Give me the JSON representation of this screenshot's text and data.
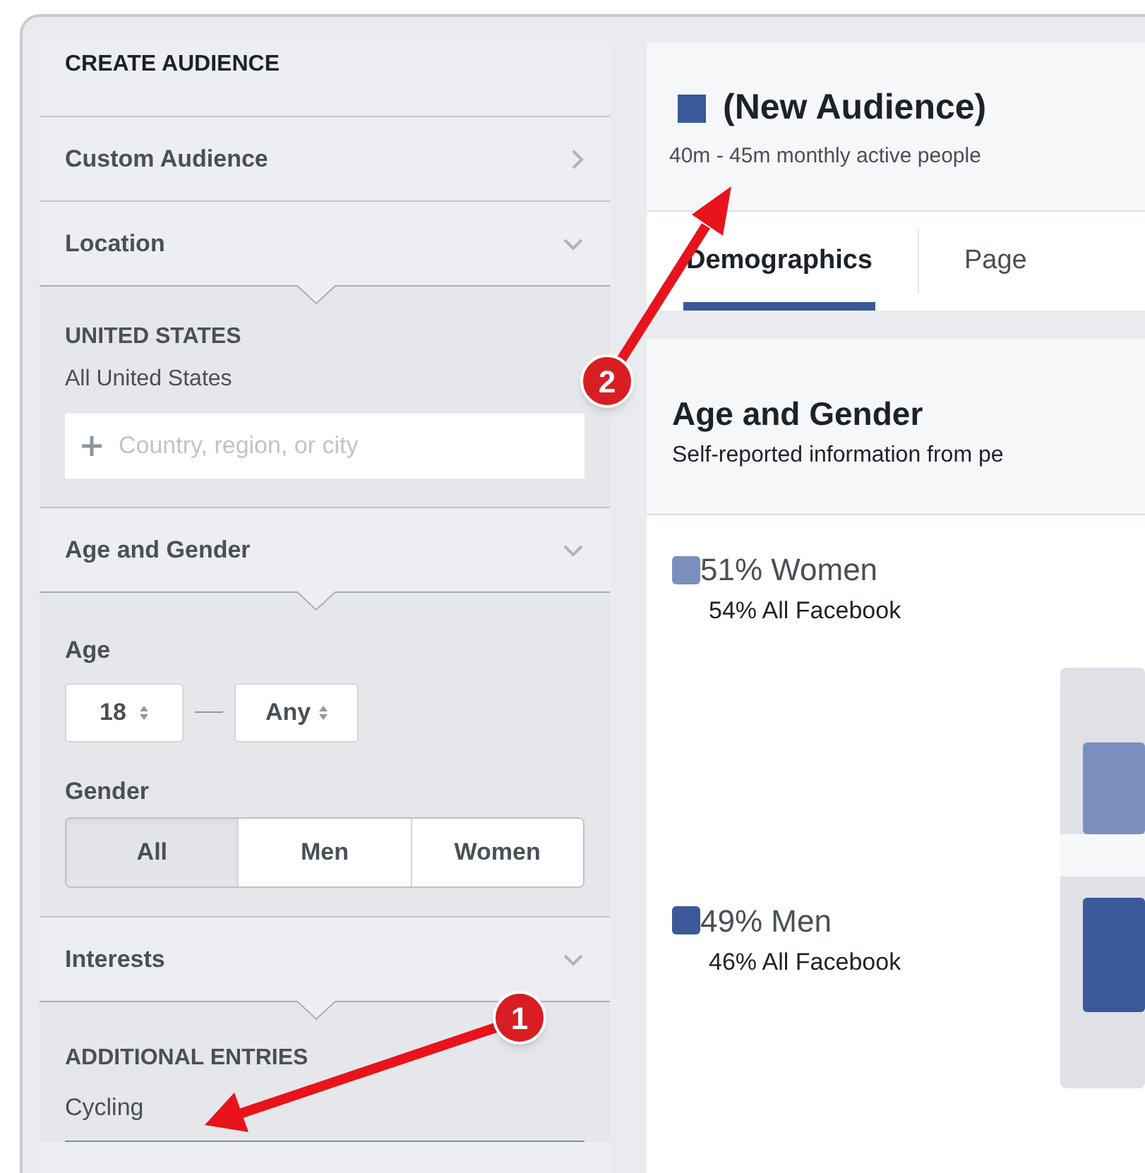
{
  "sidebar": {
    "title": "CREATE AUDIENCE",
    "sections": [
      {
        "kind": "link",
        "label": "Custom Audience"
      },
      {
        "kind": "location",
        "label": "Location",
        "expanded": true,
        "region": "UNITED STATES",
        "region_value": "All United States",
        "placeholder": "Country, region, or city"
      },
      {
        "kind": "age_gender",
        "label": "Age and Gender",
        "expanded": true,
        "age_label": "Age",
        "age_min": "18",
        "age_max": "Any",
        "gender_label": "Gender",
        "genders": [
          {
            "label": "All",
            "selected": true
          },
          {
            "label": "Men",
            "selected": false
          },
          {
            "label": "Women",
            "selected": false
          }
        ]
      },
      {
        "kind": "interests",
        "label": "Interests",
        "expanded": true,
        "group": "ADDITIONAL ENTRIES",
        "entries": [
          "Cycling"
        ]
      }
    ]
  },
  "audience": {
    "title": "(New Audience)",
    "subtitle": "40m - 45m monthly active people",
    "tabs": [
      {
        "label": "Demographics",
        "selected": true
      },
      {
        "label": "Page",
        "selected": false
      }
    ],
    "section_title": "Age and Gender",
    "section_subtitle": "Self-reported information from pe",
    "legend": [
      {
        "label": "51% Women",
        "comparison": "54% All Facebook",
        "color": "#7b8fbf"
      },
      {
        "label": "49% Men",
        "comparison": "46% All Facebook",
        "color": "#3b5998"
      }
    ]
  },
  "callouts": [
    {
      "number": "1"
    },
    {
      "number": "2"
    }
  ]
}
